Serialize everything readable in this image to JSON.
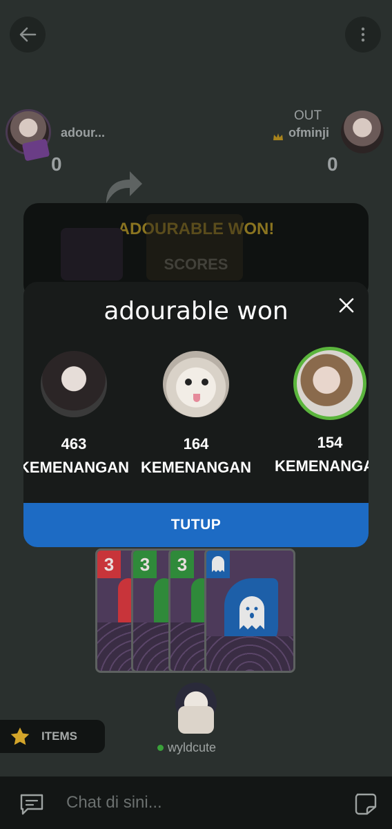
{
  "header": {
    "back_icon": "arrow-left-icon",
    "menu_icon": "more-vertical-icon"
  },
  "players": {
    "left": {
      "name": "adour...",
      "score": "0"
    },
    "right": {
      "status": "OUT",
      "name": "ofminji",
      "score": "0",
      "badge_icon": "crown-icon"
    }
  },
  "winner_panel": {
    "title": "ADOURABLE WON!",
    "scores_label": "SCORES"
  },
  "dialog": {
    "title": "adourable won",
    "close_icon": "close-icon",
    "leaders": [
      {
        "count": "463",
        "label": "KEMENANGAN"
      },
      {
        "count": "164",
        "label": "KEMENANGAN"
      },
      {
        "count": "154",
        "label": "KEMENANGAN"
      }
    ],
    "close_button": "TUTUP"
  },
  "hand": {
    "cards": [
      {
        "value": "3",
        "color": "#c8343a"
      },
      {
        "value": "3",
        "color": "#2f8a3a"
      },
      {
        "value": "3",
        "color": "#2f8a3a"
      },
      {
        "value": "ghost",
        "color": "#1d5fa8"
      }
    ]
  },
  "items_button": {
    "label": "ITEMS",
    "icon": "star-icon"
  },
  "self": {
    "name": "wyldcute",
    "status": "online"
  },
  "chat": {
    "placeholder": "Chat di sini...",
    "chat_icon": "chat-icon",
    "sticker_icon": "sticker-icon"
  },
  "colors": {
    "accent_blue": "#1d6bc4",
    "winner_gold": "#8a7420",
    "highlight_green": "#5bb53d"
  }
}
